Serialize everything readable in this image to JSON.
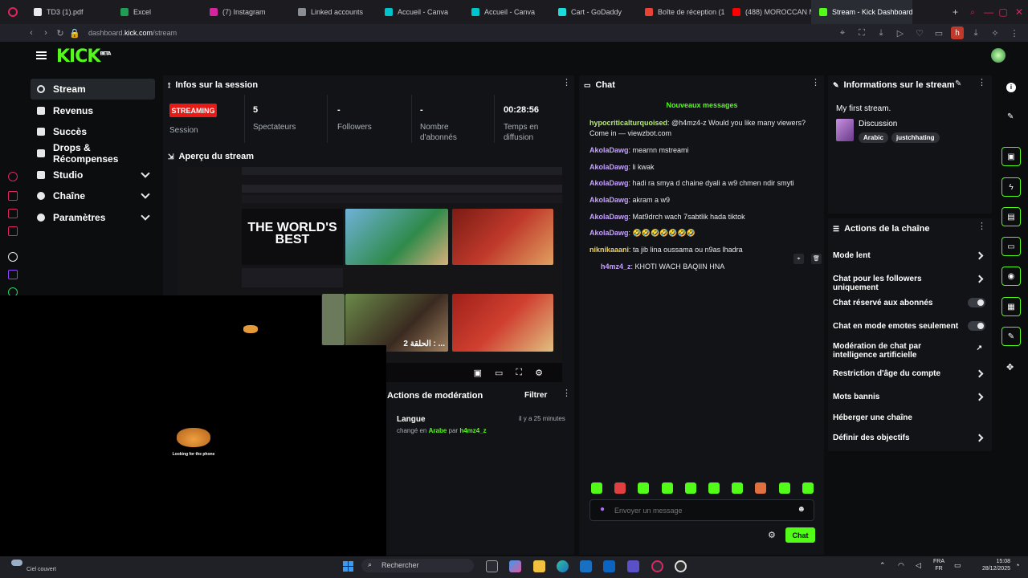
{
  "browser": {
    "tabs": [
      {
        "title": "TD3 (1).pdf",
        "color": "#e8eaed"
      },
      {
        "title": "Excel",
        "color": "#1f9d55"
      },
      {
        "title": "(7) Instagram",
        "color": "#d6249f"
      },
      {
        "title": "Linked accounts",
        "color": "#8a8d93"
      },
      {
        "title": "Accueil - Canva",
        "color": "#00c4cc"
      },
      {
        "title": "Accueil - Canva",
        "color": "#00c4cc"
      },
      {
        "title": "Cart - GoDaddy",
        "color": "#1bdbdb"
      },
      {
        "title": "Boîte de réception (1...",
        "color": "#ea4335"
      },
      {
        "title": "(488) MOROCCAN M...",
        "color": "#ff0000"
      },
      {
        "title": "Stream - Kick Dashboard",
        "color": "#53fc18"
      }
    ],
    "url": "dashboard.kick.com/stream",
    "url_host": "dashboard.",
    "url_bold": "kick.com",
    "url_path": "/stream",
    "profile_letter": "h"
  },
  "kick": {
    "logo": "KICK",
    "logo_badge": "BETA"
  },
  "sidebar": {
    "items": [
      {
        "label": "Stream"
      },
      {
        "label": "Revenus"
      },
      {
        "label": "Succès"
      },
      {
        "label": "Drops & Récompenses"
      },
      {
        "label": "Studio"
      },
      {
        "label": "Chaîne"
      },
      {
        "label": "Paramètres"
      }
    ]
  },
  "session": {
    "title": "Infos sur la session",
    "badge": "STREAMING",
    "badge_label": "Session",
    "stats": [
      {
        "value": "5",
        "label": "Spectateurs"
      },
      {
        "value": "-",
        "label": "Followers"
      },
      {
        "value": "-",
        "label": "Nombre d'abonnés"
      },
      {
        "value": "00:28:56",
        "label": "Temps en diffusion"
      }
    ]
  },
  "preview": {
    "title": "Aperçu du stream",
    "video_banner": "THE WORLD'S BEST",
    "thumb_caption_1": "الحلقة 2 : ...",
    "overlay_caption": "Looking for the phone"
  },
  "moderation": {
    "title": "Actions de modération",
    "filter_label": "Filtrer",
    "entry_title": "Langue",
    "entry_time": "il y a 25 minutes",
    "entry_changed": "changé en",
    "entry_lang": "Arabe",
    "entry_by": "par",
    "entry_user": "h4mz4_z"
  },
  "chat": {
    "title": "Chat",
    "new_messages": "Nouveaux messages",
    "messages": [
      {
        "user": "hypocriticalturquoised",
        "text": "@h4mz4-z Would you like many viewers? Come in — viewzbot.com",
        "color": "#b7f06a"
      },
      {
        "user": "AkolaDawg",
        "text": "mearnn mstreami",
        "color": "#c6a2ff"
      },
      {
        "user": "AkolaDawg",
        "text": "li kwak",
        "color": "#c6a2ff"
      },
      {
        "user": "AkolaDawg",
        "text": "hadi ra smya d chaine dyali a w9 chmen ndir smyti",
        "color": "#c6a2ff"
      },
      {
        "user": "AkolaDawg",
        "text": "akram a w9",
        "color": "#c6a2ff"
      },
      {
        "user": "AkolaDawg",
        "text": "Mat9drch wach 7sabtlik hada tiktok",
        "color": "#c6a2ff"
      },
      {
        "user": "AkolaDawg",
        "text": "🤣🤣🤣🤣🤣🤣🤣",
        "color": "#c6a2ff"
      },
      {
        "user": "niknikaaani",
        "text": "ta jib lina oussama ou n9as lhadra",
        "color": "#f0d25a"
      },
      {
        "user": "h4mz4_z",
        "text": "KHOTI WACH BAQIIN HNA",
        "color": "#c6a2ff"
      }
    ],
    "input_placeholder": "Envoyer un message",
    "send_label": "Chat"
  },
  "stream_info": {
    "title": "Informations sur le stream",
    "stream_title": "My first stream.",
    "category": "Discussion",
    "tags": [
      "Arabic",
      "justchhating"
    ]
  },
  "channel_actions": {
    "title": "Actions de la chaîne",
    "items": [
      {
        "label": "Mode lent",
        "control": "arrow"
      },
      {
        "label": "Chat pour les followers uniquement",
        "control": "arrow"
      },
      {
        "label": "Chat réservé aux abonnés",
        "control": "toggle"
      },
      {
        "label": "Chat en mode emotes seulement",
        "control": "toggle"
      },
      {
        "label": "Modération de chat par intelligence artificielle",
        "control": "external"
      },
      {
        "label": "Restriction d'âge du compte",
        "control": "arrow"
      },
      {
        "label": "Mots bannis",
        "control": "arrow"
      },
      {
        "label": "Héberger une chaîne",
        "control": "none"
      },
      {
        "label": "Définir des objectifs",
        "control": "arrow"
      }
    ]
  },
  "taskbar": {
    "weather": "Ciel couvert",
    "search_placeholder": "Rechercher",
    "lang_top": "FRA",
    "lang_bottom": "FR",
    "time": "15:08",
    "date": "28/12/2025"
  },
  "colors": {
    "accent": "#53fc18",
    "live": "#e91916"
  }
}
